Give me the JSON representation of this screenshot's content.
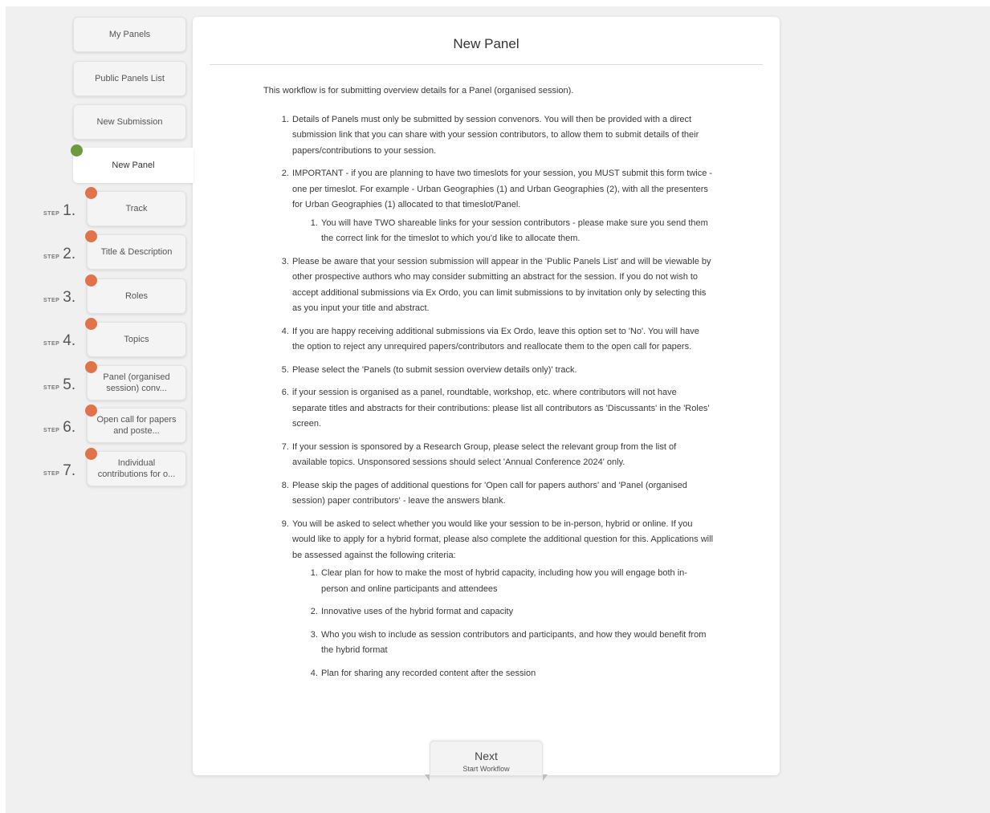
{
  "nav": {
    "my_panels": "My Panels",
    "public_panels_list": "Public Panels List",
    "new_submission": "New Submission",
    "new_panel": "New Panel"
  },
  "steps": [
    {
      "word": "STEP",
      "number": "1.",
      "label": "Track"
    },
    {
      "word": "STEP",
      "number": "2.",
      "label": "Title & Description"
    },
    {
      "word": "STEP",
      "number": "3.",
      "label": "Roles"
    },
    {
      "word": "STEP",
      "number": "4.",
      "label": "Topics"
    },
    {
      "word": "STEP",
      "number": "5.",
      "label": "Panel (organised session) conv..."
    },
    {
      "word": "STEP",
      "number": "6.",
      "label": "Open call for papers and poste..."
    },
    {
      "word": "STEP",
      "number": "7.",
      "label": "Individual contributions for o..."
    }
  ],
  "status_colors": {
    "current": "#6c9a3c",
    "incomplete": "#e0734a"
  },
  "main": {
    "title": "New Panel",
    "intro": "This workflow is for submitting overview details for a Panel (organised session).",
    "items": [
      "Details of Panels must only be submitted by session convenors. You will then be provided with a direct submission link that you can share with your session contributors, to allow them to submit details of their papers/contributions to your session.",
      "IMPORTANT - if you are planning to have two timeslots for your session, you MUST submit this form twice - one per timeslot. For example - Urban Geographies (1) and Urban Geographies (2), with all the presenters for Urban Geographies (1) allocated to that timeslot/Panel.",
      "Please be aware that your session submission will appear in the 'Public Panels List' and will be viewable by other prospective authors who may consider submitting an abstract for the session. If you do not wish to accept additional submissions via Ex Ordo, you can limit submissions to by invitation only by selecting this as you input your title and abstract.",
      "If you are happy receiving additional submissions via Ex Ordo, leave this option set to 'No'. You will have the option to reject any unrequired papers/contributors and reallocate them to the open call for papers.",
      "Please select the 'Panels (to submit session overview details only)' track.",
      "if your session is organised as a panel, roundtable, workshop, etc. where contributors will not have separate titles and abstracts for their contributions: please list all contributors as 'Discussants' in the 'Roles' screen.",
      "If your session is sponsored by a Research Group, please select the relevant group from the list of available topics. Unsponsored sessions should select 'Annual Conference 2024' only.",
      "Please skip the pages of additional questions for 'Open call for papers authors' and 'Panel (organised session) paper contributors' - leave the answers blank.",
      "You will be asked to select whether you would like your session to be in-person, hybrid or online. If you would like to apply for a hybrid format, please also complete the additional question for this. Applications will be assessed against the following criteria:"
    ],
    "item2_sub": [
      "You will have TWO shareable links for your session contributors - please make sure you send them the correct link for the timeslot to which you'd like to allocate them."
    ],
    "item9_sub": [
      "Clear plan for how to make the most of hybrid capacity, including how you will engage both in-person and online participants and attendees",
      "Innovative uses of the hybrid format and capacity",
      "Who you wish to include as session contributors and participants, and how they would benefit from the hybrid format",
      "Plan for sharing any recorded content after the session"
    ]
  },
  "footer": {
    "next_label": "Next",
    "next_sub": "Start Workflow"
  }
}
